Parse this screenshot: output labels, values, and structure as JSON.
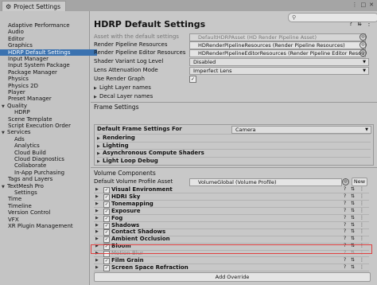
{
  "window": {
    "title": "Project Settings"
  },
  "sidebar": {
    "items": [
      {
        "label": "Adaptive Performance",
        "indent": 0,
        "arrow": false
      },
      {
        "label": "Audio",
        "indent": 0,
        "arrow": false
      },
      {
        "label": "Editor",
        "indent": 0,
        "arrow": false
      },
      {
        "label": "Graphics",
        "indent": 0,
        "arrow": false
      },
      {
        "label": "HDRP Default Settings",
        "indent": 0,
        "arrow": false,
        "selected": true
      },
      {
        "label": "Input Manager",
        "indent": 0,
        "arrow": false
      },
      {
        "label": "Input System Package",
        "indent": 0,
        "arrow": false
      },
      {
        "label": "Package Manager",
        "indent": 0,
        "arrow": false
      },
      {
        "label": "Physics",
        "indent": 0,
        "arrow": false
      },
      {
        "label": "Physics 2D",
        "indent": 0,
        "arrow": false
      },
      {
        "label": "Player",
        "indent": 0,
        "arrow": false
      },
      {
        "label": "Preset Manager",
        "indent": 0,
        "arrow": false
      },
      {
        "label": "Quality",
        "indent": 0,
        "arrow": true
      },
      {
        "label": "HDRP",
        "indent": 1,
        "arrow": false
      },
      {
        "label": "Scene Template",
        "indent": 0,
        "arrow": false
      },
      {
        "label": "Script Execution Order",
        "indent": 0,
        "arrow": false
      },
      {
        "label": "Services",
        "indent": 0,
        "arrow": true
      },
      {
        "label": "Ads",
        "indent": 1,
        "arrow": false
      },
      {
        "label": "Analytics",
        "indent": 1,
        "arrow": false
      },
      {
        "label": "Cloud Build",
        "indent": 1,
        "arrow": false
      },
      {
        "label": "Cloud Diagnostics",
        "indent": 1,
        "arrow": false
      },
      {
        "label": "Collaborate",
        "indent": 1,
        "arrow": false
      },
      {
        "label": "In-App Purchasing",
        "indent": 1,
        "arrow": false
      },
      {
        "label": "Tags and Layers",
        "indent": 0,
        "arrow": false
      },
      {
        "label": "TextMesh Pro",
        "indent": 0,
        "arrow": true
      },
      {
        "label": "Settings",
        "indent": 1,
        "arrow": false
      },
      {
        "label": "Time",
        "indent": 0,
        "arrow": false
      },
      {
        "label": "Timeline",
        "indent": 0,
        "arrow": false
      },
      {
        "label": "Version Control",
        "indent": 0,
        "arrow": false
      },
      {
        "label": "VFX",
        "indent": 0,
        "arrow": false
      },
      {
        "label": "XR Plugin Management",
        "indent": 0,
        "arrow": false
      }
    ]
  },
  "main": {
    "title": "HDRP Default Settings",
    "asset_label": "Asset with the default settings",
    "asset_value": "DefaultHDRPAsset (HD Render Pipeline Asset)",
    "render_res_label": "Render Pipeline Resources",
    "render_res_value": "HDRenderPipelineResources (Render Pipeline Resources)",
    "render_editor_res_label": "Render Pipeline Editor Resources",
    "render_editor_res_value": "HDRenderPipelineEditorResources (Render Pipeline Editor Resou",
    "shader_log_label": "Shader Variant Log Level",
    "shader_log_value": "Disabled",
    "lens_att_label": "Lens Attenuation Mode",
    "lens_att_value": "Imperfect Lens",
    "use_render_graph_label": "Use Render Graph",
    "light_layer_names": "Light Layer names",
    "decal_layer_names": "Decal Layer names",
    "frame_settings_header": "Frame Settings",
    "frame_settings_for_label": "Default Frame Settings For",
    "frame_settings_for_value": "Camera",
    "frame_sections": [
      "Rendering",
      "Lighting",
      "Asynchronous Compute Shaders",
      "Light Loop Debug"
    ],
    "volume_header": "Volume Components",
    "volume_profile_label": "Default Volume Profile Asset",
    "volume_profile_value": "VolumeGlobal (Volume Profile)",
    "new_button": "New",
    "volume_items": [
      {
        "label": "Visual Environment",
        "checked": true,
        "enabled": true
      },
      {
        "label": "HDRI Sky",
        "checked": true,
        "enabled": true
      },
      {
        "label": "Tonemapping",
        "checked": true,
        "enabled": true
      },
      {
        "label": "Exposure",
        "checked": true,
        "enabled": true
      },
      {
        "label": "Fog",
        "checked": true,
        "enabled": true
      },
      {
        "label": "Shadows",
        "checked": true,
        "enabled": true
      },
      {
        "label": "Contact Shadows",
        "checked": true,
        "enabled": true
      },
      {
        "label": "Ambient Occlusion",
        "checked": true,
        "enabled": true
      },
      {
        "label": "Bloom",
        "checked": true,
        "enabled": true
      },
      {
        "label": "Motion Blur",
        "checked": false,
        "enabled": false
      },
      {
        "label": "Film Grain",
        "checked": true,
        "enabled": true
      },
      {
        "label": "Screen Space Refraction",
        "checked": true,
        "enabled": true
      }
    ],
    "add_override": "Add Override"
  },
  "colors": {
    "selection": "#3a72b0",
    "highlight": "#e04040"
  }
}
